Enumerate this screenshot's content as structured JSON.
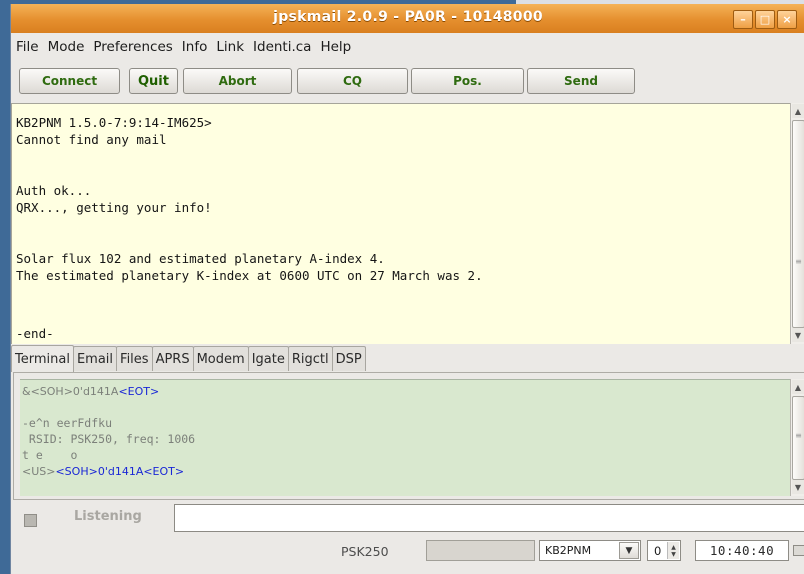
{
  "window": {
    "title": "jpskmail 2.0.9 - PA0R - 10148000",
    "controls": {
      "minimize": "–",
      "maximize": "□",
      "close": "×"
    }
  },
  "menu": [
    "File",
    "Mode",
    "Preferences",
    "Info",
    "Link",
    "Identi.ca",
    "Help"
  ],
  "toolbar": {
    "connect": "Connect",
    "quit": "Quit",
    "abort": "Abort",
    "cq": "CQ",
    "pos": "Pos.",
    "send": "Send"
  },
  "terminal_lines": [
    "KB2PNM 1.5.0-7:9:14-IM625>",
    "Cannot find any mail",
    "",
    "",
    "Auth ok...",
    "QRX..., getting your info!",
    "",
    "",
    "Solar flux 102 and estimated planetary A-index 4.",
    "The estimated planetary K-index at 0600 UTC on 27 March was 2.",
    "",
    "",
    "",
    "-end-"
  ],
  "tabs": [
    "Terminal",
    "Email",
    "Files",
    "APRS",
    "Modem",
    "Igate",
    "Rigctl",
    "DSP"
  ],
  "active_tab": "Terminal",
  "monitor": {
    "line1_a": "&<SOH>0'd141A",
    "line1_b": "<EOT>",
    "line2": "",
    "line3": "-e^n eerFdfku",
    "line4": " RSID: PSK250, freq: 1006",
    "line5": "t e    o",
    "line6_a": "<US>",
    "line6_b": "<SOH>0'd141A<EOT>"
  },
  "status": {
    "listening": "Listening",
    "mode": "PSK250",
    "callsign": "KB2PNM",
    "channel": "0",
    "time": "10:40:40",
    "input_value": ""
  },
  "colors": {
    "titlebar": "#e58f2e",
    "terminal_bg": "#ffffe1",
    "monitor_bg": "#d9e8cf",
    "control_blue": "#1a27d6",
    "button_text": "#2f6b10"
  }
}
